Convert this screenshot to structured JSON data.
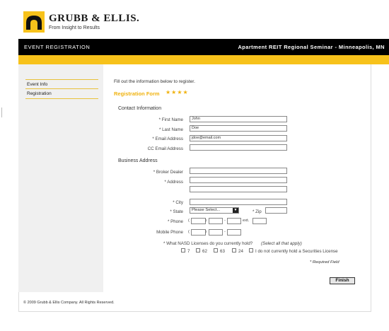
{
  "brand": {
    "name": "GRUBB & ELLIS.",
    "tagline": "From Insight to Results"
  },
  "header": {
    "left_title": "EVENT REGISTRATION",
    "right_title": "Apartment REIT Regional Seminar - Minneapolis, MN"
  },
  "sidebar": {
    "items": [
      {
        "label": "Event Info"
      },
      {
        "label": "Registration"
      }
    ]
  },
  "main": {
    "intro": "Fill out the information below to register.",
    "form_title": "Registration Form",
    "stars": "★★★★"
  },
  "contact": {
    "heading": "Contact Information",
    "first_name_label": "* First Name",
    "first_name_value": "John",
    "last_name_label": "* Last Name",
    "last_name_value": "Doe",
    "email_label": "* Email Address",
    "email_value": "jdoe@email.com",
    "cc_email_label": "CC Email Address",
    "cc_email_value": ""
  },
  "business": {
    "heading": "Business Address",
    "broker_label": "* Broker Dealer",
    "address_label": "* Address",
    "city_label": "* City",
    "state_label": "* State",
    "state_value": "Please Select...",
    "zip_label": "* Zip",
    "phone_label": "* Phone",
    "ext_label": "ext.",
    "mobile_label": "Mobile Phone"
  },
  "licenses": {
    "question": "* What NASD Licenses do you currently hold?",
    "note": "(Select all that apply)",
    "options": [
      {
        "label": "7"
      },
      {
        "label": "62"
      },
      {
        "label": "63"
      },
      {
        "label": "24"
      },
      {
        "label": "I do not currently hold a Securities License"
      }
    ]
  },
  "required_note": "* Required Field",
  "finish_label": "Finish",
  "footer": "© 2009 Grubb & Ellis Company. All Rights Reserved.",
  "colors": {
    "accent": "#f7c21b",
    "header_bg": "#000000",
    "sidebar_bg": "#f0f0f0"
  }
}
